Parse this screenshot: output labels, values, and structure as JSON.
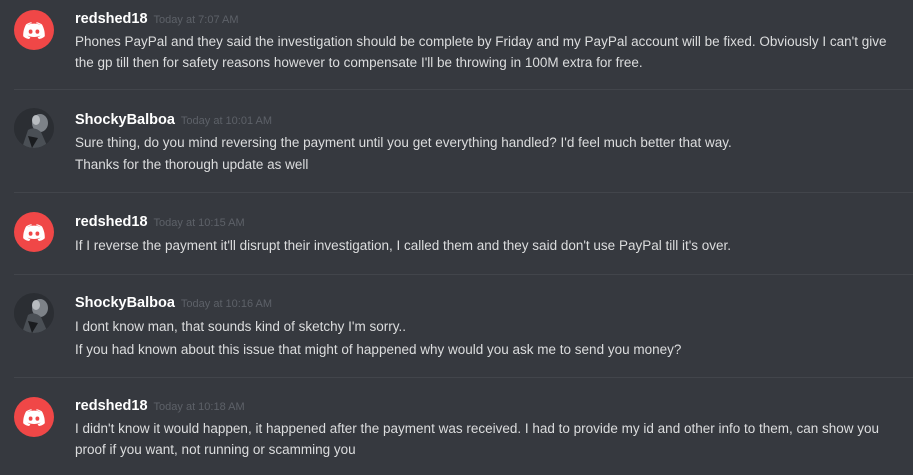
{
  "messages": [
    {
      "author": "redshed18",
      "avatar": "discord-logo-icon",
      "timestamp": "Today at 7:07 AM",
      "lines": [
        "Phones PayPal and they said the investigation should be complete by Friday and my PayPal account will be fixed. Obviously I can't give the gp till then for safety reasons however to compensate I'll be throwing in 100M extra for free."
      ]
    },
    {
      "author": "ShockyBalboa",
      "avatar": "user-photo-avatar",
      "timestamp": "Today at 10:01 AM",
      "lines": [
        "Sure thing, do you mind reversing the payment until you get everything handled? I'd feel much better that way.",
        "Thanks for the thorough update as well"
      ]
    },
    {
      "author": "redshed18",
      "avatar": "discord-logo-icon",
      "timestamp": "Today at 10:15 AM",
      "lines": [
        "If I reverse the payment it'll disrupt their investigation, I called them and they said don't use PayPal till it's over."
      ]
    },
    {
      "author": "ShockyBalboa",
      "avatar": "user-photo-avatar",
      "timestamp": "Today at 10:16 AM",
      "lines": [
        "I dont know man, that sounds kind of sketchy I'm sorry..",
        "If you had known about this issue that might of happened why would you ask me to send you money?"
      ]
    },
    {
      "author": "redshed18",
      "avatar": "discord-logo-icon",
      "timestamp": "Today at 10:18 AM",
      "lines": [
        "I didn't know it would happen, it happened after the payment was received. I had to provide my id and other info to them, can show you proof if you want, not running or scamming you"
      ]
    }
  ],
  "colors": {
    "background": "#36393f",
    "discord_avatar": "#f04747",
    "username": "#ffffff",
    "timestamp": "#5d6168",
    "message_text": "#dcddde"
  }
}
